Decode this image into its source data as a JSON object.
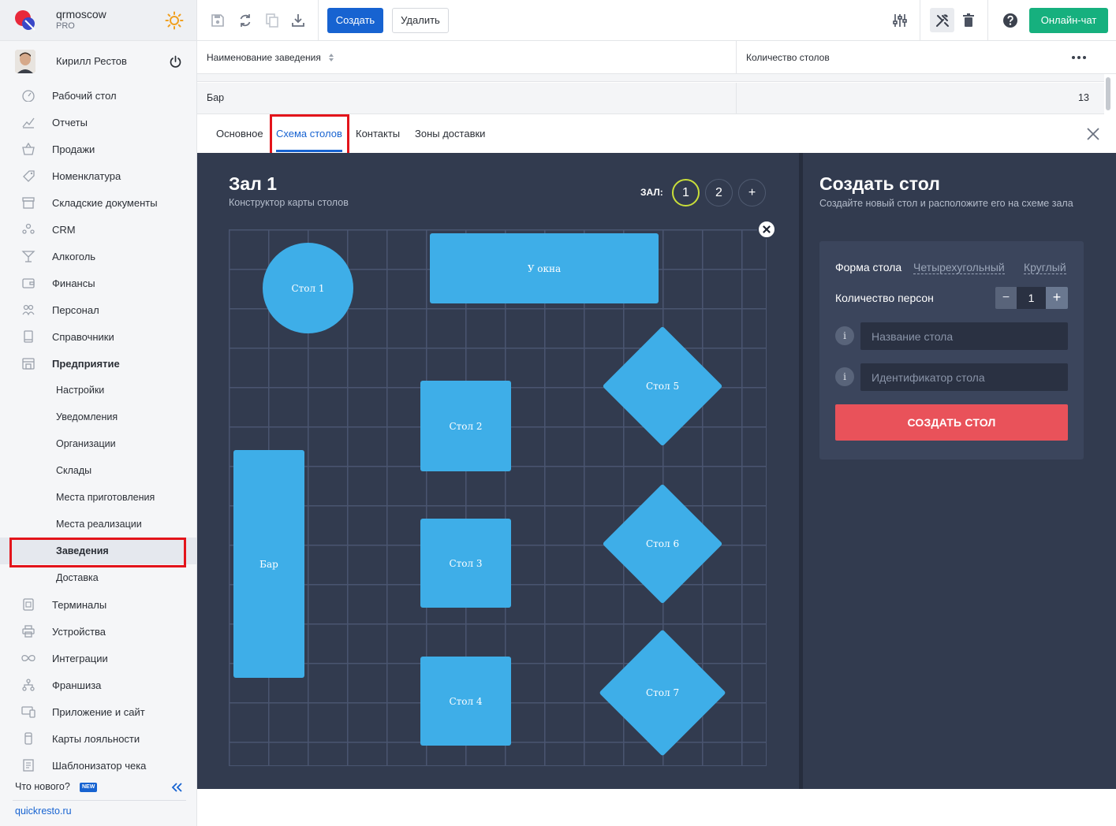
{
  "app": {
    "name": "qrmoscow",
    "plan": "PRO",
    "user_name": "Кирилл Рестов"
  },
  "sidebar": {
    "items": [
      {
        "label": "Рабочий стол",
        "icon": "dashboard-icon"
      },
      {
        "label": "Отчеты",
        "icon": "chart-icon"
      },
      {
        "label": "Продажи",
        "icon": "basket-icon"
      },
      {
        "label": "Номенклатура",
        "icon": "tag-icon"
      },
      {
        "label": "Складские документы",
        "icon": "box-icon"
      },
      {
        "label": "CRM",
        "icon": "people-icon"
      },
      {
        "label": "Алкоголь",
        "icon": "cocktail-icon"
      },
      {
        "label": "Финансы",
        "icon": "wallet-icon"
      },
      {
        "label": "Персонал",
        "icon": "staff-icon"
      },
      {
        "label": "Справочники",
        "icon": "book-icon"
      },
      {
        "label": "Предприятие",
        "icon": "building-icon"
      }
    ],
    "enterprise_sub": [
      {
        "label": "Настройки"
      },
      {
        "label": "Уведомления"
      },
      {
        "label": "Организации"
      },
      {
        "label": "Склады"
      },
      {
        "label": "Места приготовления"
      },
      {
        "label": "Места реализации"
      },
      {
        "label": "Заведения"
      },
      {
        "label": "Доставка"
      }
    ],
    "items_after": [
      {
        "label": "Терминалы",
        "icon": "qr-icon"
      },
      {
        "label": "Устройства",
        "icon": "printer-icon"
      },
      {
        "label": "Интеграции",
        "icon": "infinity-icon"
      },
      {
        "label": "Франшиза",
        "icon": "network-icon"
      },
      {
        "label": "Приложение и сайт",
        "icon": "devices-icon"
      },
      {
        "label": "Карты лояльности",
        "icon": "card-icon"
      },
      {
        "label": "Шаблонизатор чека",
        "icon": "receipt-icon"
      }
    ],
    "whats_new": "Что нового?",
    "new_badge": "NEW",
    "footer_link": "quickresto.ru"
  },
  "toolbar": {
    "create_label": "Создать",
    "delete_label": "Удалить",
    "chat_label": "Онлайн-чат"
  },
  "table": {
    "columns": [
      "Наименование заведения",
      "Количество столов"
    ],
    "rows": [
      {
        "name": "Бар",
        "tables": "13"
      }
    ]
  },
  "tabs": [
    {
      "label": "Основное"
    },
    {
      "label": "Схема столов"
    },
    {
      "label": "Контакты"
    },
    {
      "label": "Зоны доставки"
    }
  ],
  "editor": {
    "title": "Зал 1",
    "subtitle": "Конструктор карты столов",
    "hall_label": "ЗАЛ:",
    "halls": [
      "1",
      "2",
      "+"
    ],
    "tables": [
      {
        "label": "Стол 1"
      },
      {
        "label": "У окна"
      },
      {
        "label": "Стол 2"
      },
      {
        "label": "Стол 5"
      },
      {
        "label": "Бар"
      },
      {
        "label": "Стол 3"
      },
      {
        "label": "Стол 6"
      },
      {
        "label": "Стол 4"
      },
      {
        "label": "Стол 7"
      }
    ]
  },
  "create_panel": {
    "title": "Создать стол",
    "subtitle": "Создайте новый стол и расположите его на схеме зала",
    "shape_label": "Форма стола",
    "shape_options": [
      "Четырехугольный",
      "Круглый"
    ],
    "persons_label": "Количество персон",
    "persons_value": "1",
    "name_placeholder": "Название стола",
    "id_placeholder": "Идентификатор стола",
    "submit_label": "СОЗДАТЬ СТОЛ"
  },
  "colors": {
    "accent": "#1763d1",
    "chat": "#16b07e",
    "table_fill": "#3eaee8",
    "editor_bg": "#323b4f",
    "submit": "#e9525a",
    "highlight": "#e3141b"
  }
}
